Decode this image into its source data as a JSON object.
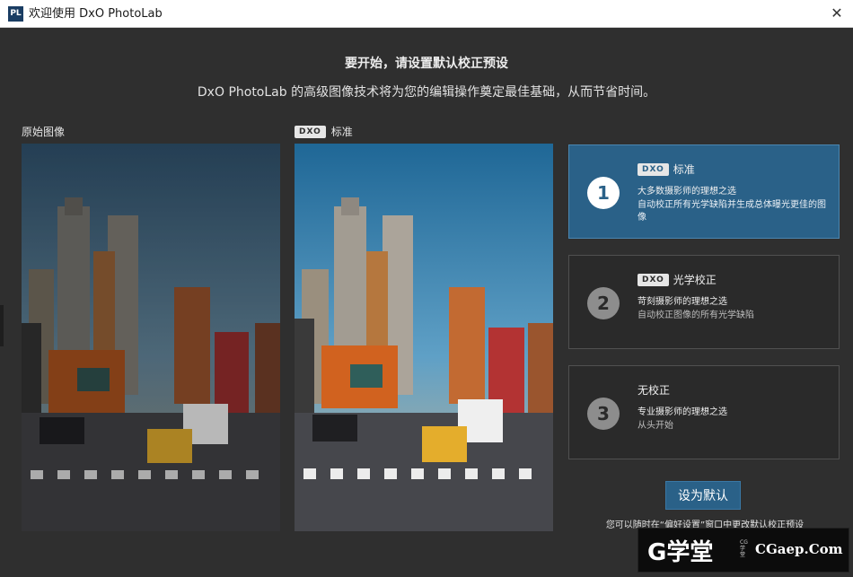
{
  "window": {
    "app_icon": "PL",
    "title": "欢迎使用 DxO PhotoLab",
    "close_glyph": "✕"
  },
  "header": {
    "heading": "要开始，请设置默认校正预设",
    "subheading": "DxO PhotoLab 的高级图像技术将为您的编辑操作奠定最佳基础，从而节省时间。"
  },
  "preview": {
    "original_label": "原始图像",
    "standard_badge": "DXO",
    "standard_label": "标准"
  },
  "options": [
    {
      "number": "1",
      "badge": "DXO",
      "title": "标准",
      "subtitle": "大多数摄影师的理想之选",
      "description": "自动校正所有光学缺陷并生成总体曝光更佳的图像",
      "selected": true
    },
    {
      "number": "2",
      "badge": "DXO",
      "title": "光学校正",
      "subtitle": "苛刻摄影师的理想之选",
      "description": "自动校正图像的所有光学缺陷",
      "selected": false
    },
    {
      "number": "3",
      "badge": "",
      "title": "无校正",
      "subtitle": "专业摄影师的理想之选",
      "description": "从头开始",
      "selected": false
    }
  ],
  "actions": {
    "set_default_label": "设为默认",
    "footnote": "您可以随时在“偏好设置”窗口中更改默认校正预设"
  },
  "watermark": {
    "logo": "G学堂",
    "small": "CG学堂",
    "site": "CGaep.Com"
  },
  "colors": {
    "accent": "#2a6188",
    "background": "#2f2f2f"
  }
}
